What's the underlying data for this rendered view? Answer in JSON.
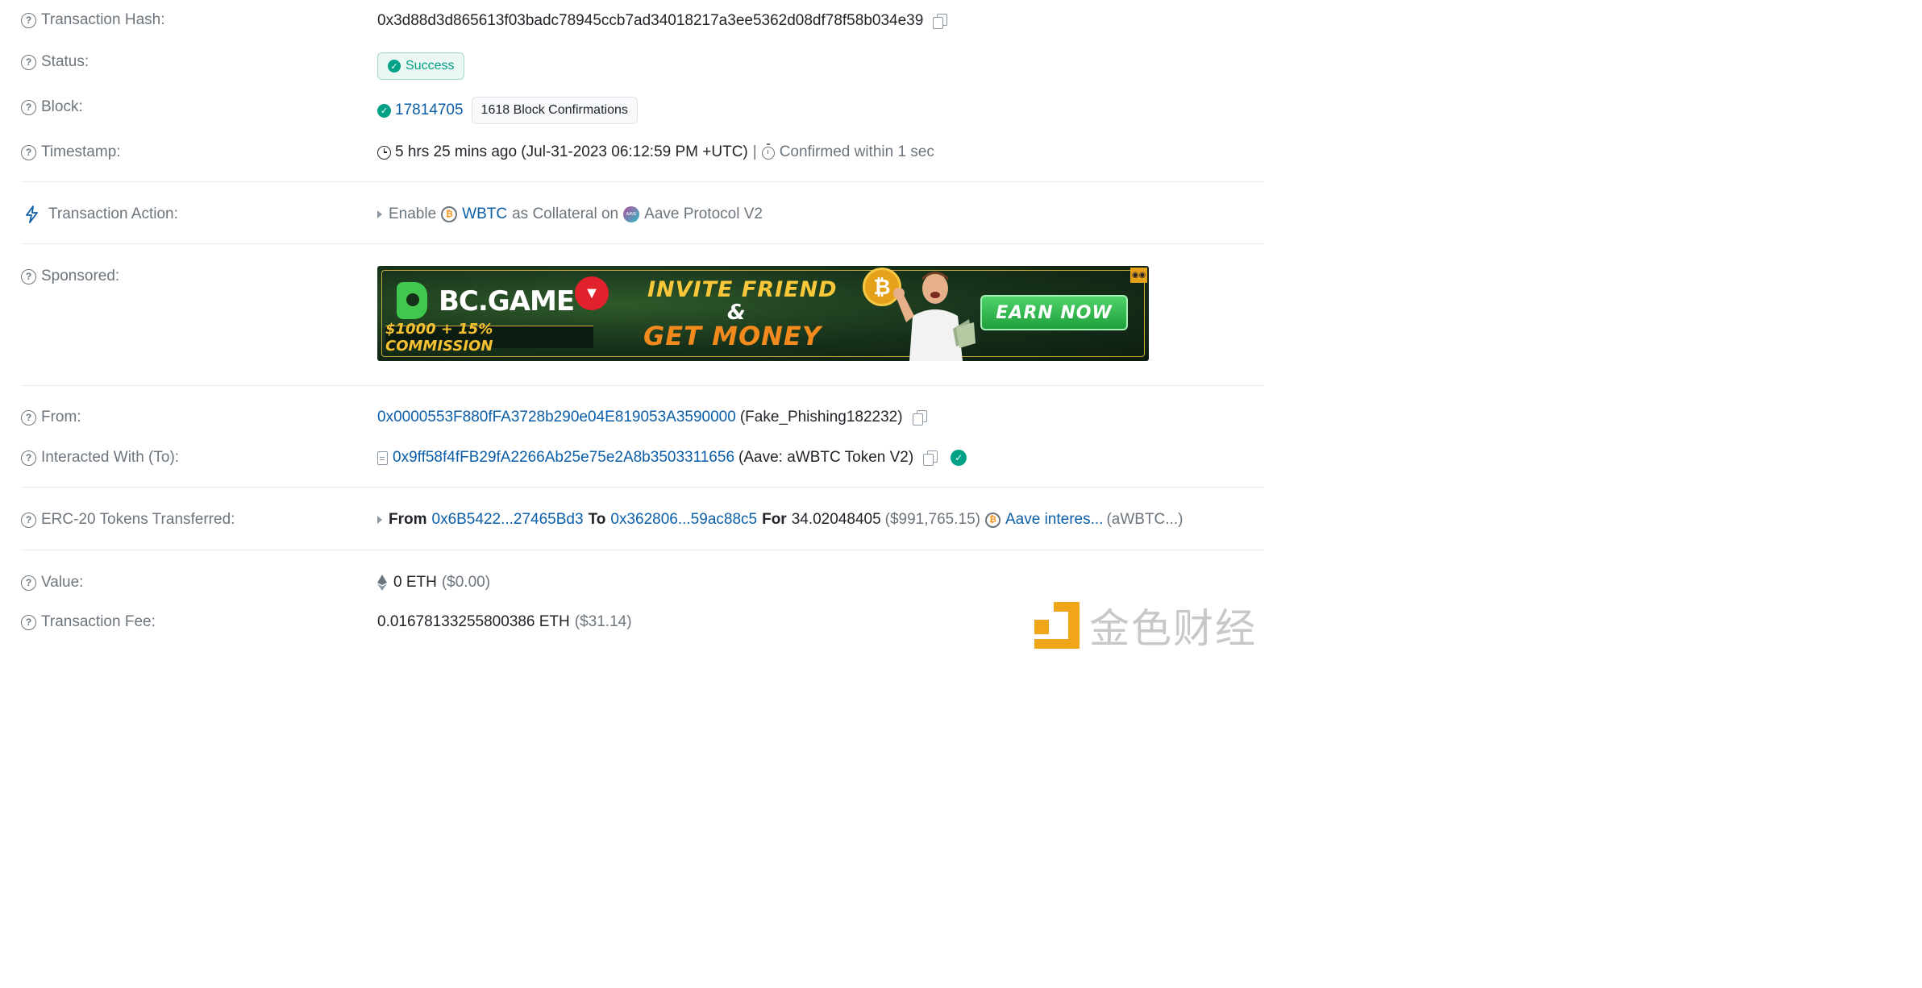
{
  "rows": {
    "tx_hash": {
      "label": "Transaction Hash:",
      "value": "0x3d88d3d865613f03badc78945ccb7ad34018217a3ee5362d08df78f58b034e39"
    },
    "status": {
      "label": "Status:",
      "value": "Success"
    },
    "block": {
      "label": "Block:",
      "number": "17814705",
      "confirmations": "1618 Block Confirmations"
    },
    "timestamp": {
      "label": "Timestamp:",
      "value": "5 hrs 25 mins ago (Jul-31-2023 06:12:59 PM +UTC)",
      "separator": "|",
      "confirmed": "Confirmed within 1 sec"
    },
    "action": {
      "label": "Transaction Action:",
      "verb": "Enable",
      "token": "WBTC",
      "middle": "as Collateral on",
      "protocol": "Aave Protocol V2"
    },
    "sponsored": {
      "label": "Sponsored:",
      "brand": "BC.GAME",
      "commission": "$1000 + 15% COMMISSION",
      "line1": "INVITE FRIEND",
      "line2": "&",
      "line3": "GET MONEY",
      "cta": "EARN NOW"
    },
    "from": {
      "label": "From:",
      "address": "0x0000553F880fFA3728b290e04E819053A3590000",
      "name": "(Fake_Phishing182232)"
    },
    "to": {
      "label": "Interacted With (To):",
      "address": "0x9ff58f4fFB29fA2266Ab25e75e2A8b3503311656",
      "name": "(Aave: aWBTC Token V2)"
    },
    "erc20": {
      "label": "ERC-20 Tokens Transferred:",
      "from_kw": "From",
      "from_addr": "0x6B5422...27465Bd3",
      "to_kw": "To",
      "to_addr": "0x362806...59ac88c5",
      "for_kw": "For",
      "amount": "34.02048405",
      "usd": "($991,765.15)",
      "token": "Aave interes...",
      "symbol": "(aWBTC...)"
    },
    "value": {
      "label": "Value:",
      "eth": "0 ETH",
      "usd": "($0.00)"
    },
    "fee": {
      "label": "Transaction Fee:",
      "eth": "0.01678133255800386 ETH",
      "usd": "($31.14)"
    }
  },
  "watermark": {
    "text": "金色财经"
  },
  "colors": {
    "link": "#0b5ea8",
    "success": "#00a186",
    "muted": "#6c757d"
  }
}
